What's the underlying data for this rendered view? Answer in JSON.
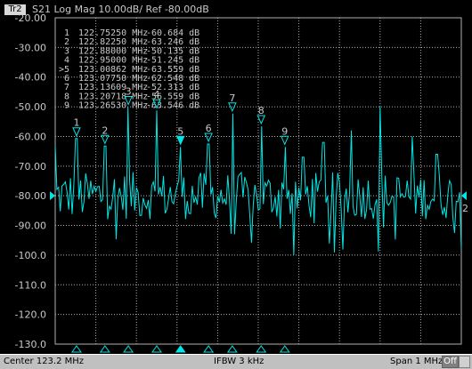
{
  "header": {
    "tab": "Tr2",
    "title": "S21 Log Mag 10.00dB/ Ref -80.00dB"
  },
  "chart_data": {
    "type": "line",
    "series": [
      {
        "color": "#00e5e5",
        "x_range_mhz": [
          122.7,
          123.7
        ],
        "display": "noisy spectrum with peaks at markers"
      }
    ],
    "ylim": [
      -130,
      -20
    ],
    "y_ticks": [
      "-20.00",
      "-30.00",
      "-40.00",
      "-50.00",
      "-60.00",
      "-70.00",
      "-80.00",
      "-90.00",
      "-100.0",
      "-110.0",
      "-120.0",
      "-130.0"
    ],
    "reference_level": -80,
    "grid": true,
    "markers": [
      {
        "num": "1",
        "active": false,
        "freq": "122.75250 MHz",
        "value": "-60.684 dB",
        "freq_mhz": 122.7525,
        "db": -60.684
      },
      {
        "num": "2",
        "active": false,
        "freq": "122.82250 MHz",
        "value": "-63.246 dB",
        "freq_mhz": 122.8225,
        "db": -63.246
      },
      {
        "num": "3",
        "active": false,
        "freq": "122.88000 MHz",
        "value": "-50.135 dB",
        "freq_mhz": 122.88,
        "db": -50.135
      },
      {
        "num": "4",
        "active": false,
        "freq": "122.95000 MHz",
        "value": "-51.245 dB",
        "freq_mhz": 122.95,
        "db": -51.245
      },
      {
        "num": "5",
        "active": true,
        "freq": "123.00862 MHz",
        "value": "-63.559 dB",
        "freq_mhz": 123.00862,
        "db": -63.559
      },
      {
        "num": "6",
        "active": false,
        "freq": "123.07750 MHz",
        "value": "-62.548 dB",
        "freq_mhz": 123.0775,
        "db": -62.548
      },
      {
        "num": "7",
        "active": false,
        "freq": "123.13609 MHz",
        "value": "-52.313 dB",
        "freq_mhz": 123.13609,
        "db": -52.313
      },
      {
        "num": "8",
        "active": false,
        "freq": "123.20718 MHz",
        "value": "-56.559 dB",
        "freq_mhz": 123.20718,
        "db": -56.559
      },
      {
        "num": "9",
        "active": false,
        "freq": "123.26530 MHz",
        "value": "-63.546 dB",
        "freq_mhz": 123.2653,
        "db": -63.546
      }
    ],
    "channel_label": "2"
  },
  "status": {
    "center": "Center 123.2 MHz",
    "ifbw": "IFBW 3 kHz",
    "span": "Span 1 MHz",
    "off": "Off"
  },
  "colors": {
    "trace": "#00e5e5",
    "grid": "#b0b0b0",
    "text": "#c8c8c8"
  }
}
